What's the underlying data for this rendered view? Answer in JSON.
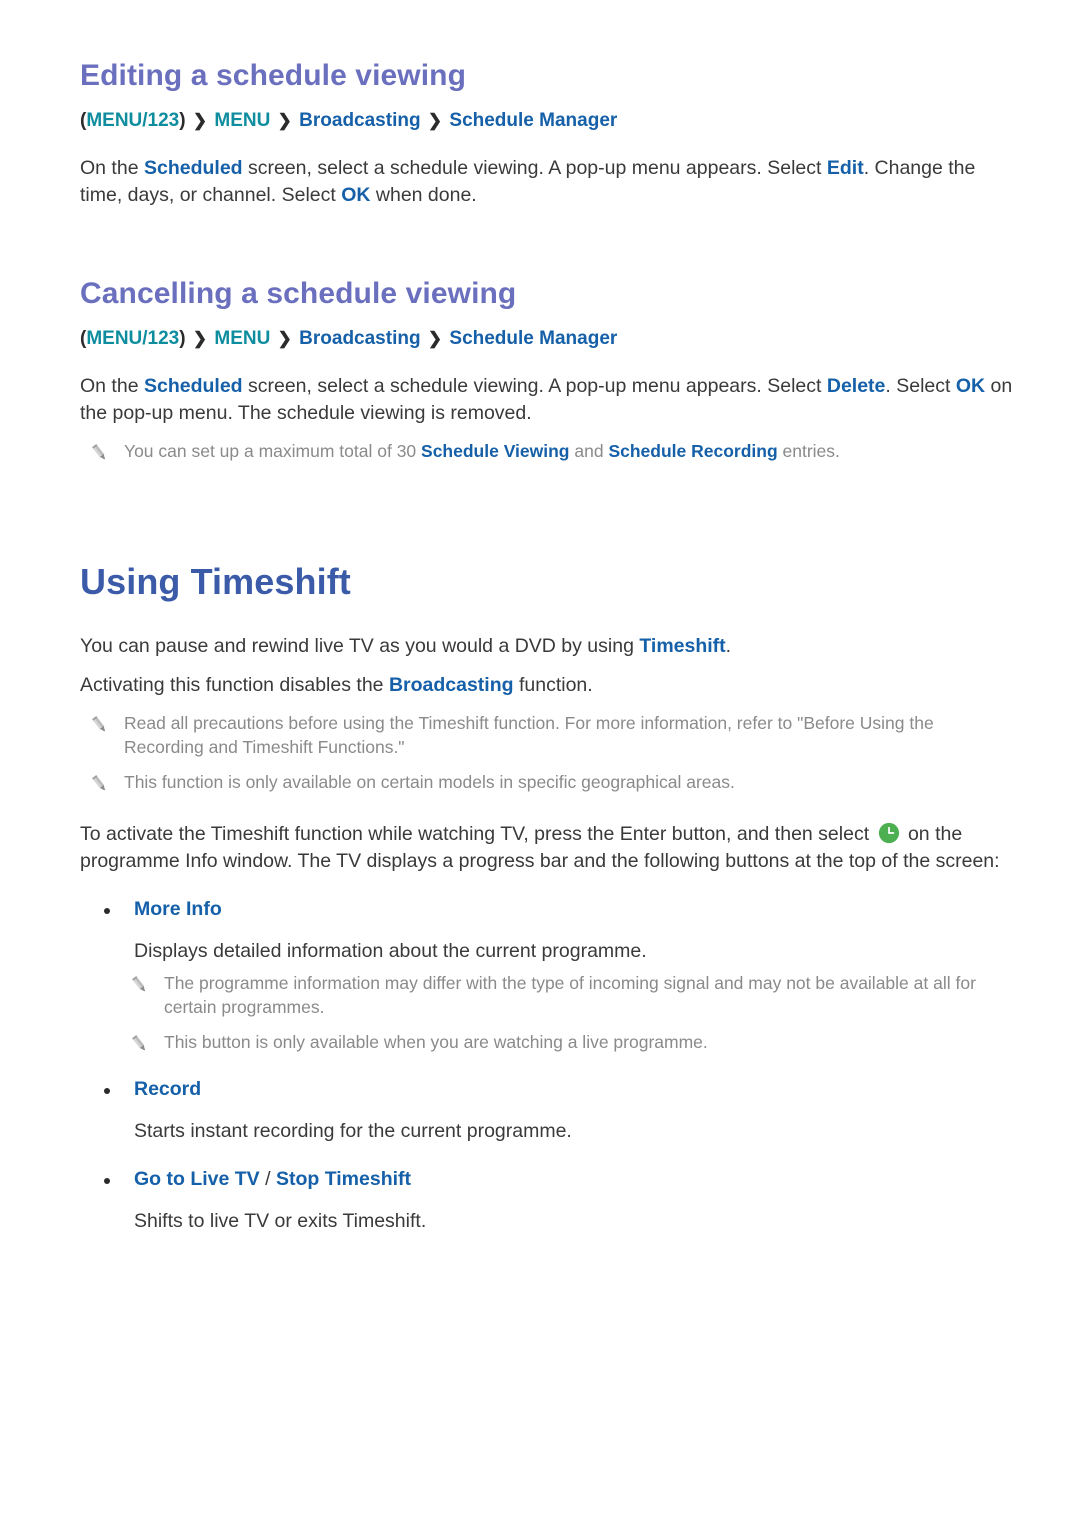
{
  "document": {
    "colors": {
      "section_heading": "#6a6fbe",
      "chapter_heading": "#3b5ba9",
      "link": "#1560a8",
      "menu_key": "#0e8d9f",
      "body_text": "#3a3a3a",
      "note_text": "#8a8a8a",
      "clock_icon_green": "#4caf50"
    }
  },
  "sections": [
    {
      "heading": "Editing a schedule viewing",
      "breadcrumb": {
        "menu_key": "MENU/123",
        "open_paren": "(",
        "close_paren": ")",
        "separator": "❯",
        "items": [
          "MENU",
          "Broadcasting",
          "Schedule Manager"
        ]
      },
      "paragraph": {
        "p1": "On the ",
        "link1": "Scheduled",
        "p2": " screen, select a schedule viewing. A pop-up menu appears. Select ",
        "link2": "Edit",
        "p3": ". Change the time, days, or channel. Select ",
        "link3": "OK",
        "p4": " when done."
      }
    },
    {
      "heading": "Cancelling a schedule viewing",
      "breadcrumb": {
        "menu_key": "MENU/123",
        "open_paren": "(",
        "close_paren": ")",
        "separator": "❯",
        "items": [
          "MENU",
          "Broadcasting",
          "Schedule Manager"
        ]
      },
      "paragraph": {
        "p1": "On the ",
        "link1": "Scheduled",
        "p2": " screen, select a schedule viewing. A pop-up menu appears. Select ",
        "link2": "Delete",
        "p3": ". Select ",
        "link3": "OK",
        "p4": " on the pop-up menu. The schedule viewing is removed."
      },
      "note": {
        "icon": "pencil-icon",
        "t1": "You can set up a maximum total of 30 ",
        "link1": "Schedule Viewing",
        "t2": " and ",
        "link2": "Schedule Recording",
        "t3": " entries."
      }
    }
  ],
  "chapter": {
    "title": "Using Timeshift",
    "intro": {
      "line1_p1": "You can pause and rewind live TV as you would a DVD by using ",
      "line1_link": "Timeshift",
      "line1_p2": ".",
      "line2_p1": "Activating this function disables the ",
      "line2_link": "Broadcasting",
      "line2_p2": " function."
    },
    "notes": [
      {
        "icon": "pencil-icon",
        "text": "Read all precautions before using the Timeshift function. For more information, refer to \"Before Using the Recording and Timeshift Functions.\""
      },
      {
        "icon": "pencil-icon",
        "text": "This function is only available on certain models in specific geographical areas."
      }
    ],
    "activation": {
      "p1": "To activate the Timeshift function while watching TV, press the Enter button, and then select ",
      "icon": "clock-icon",
      "p2": " on the programme Info window. The TV displays a progress bar and the following buttons at the top of the screen:"
    },
    "buttons": [
      {
        "label": "More Info",
        "label_alt": "",
        "separator": "",
        "description": "Displays detailed information about the current programme.",
        "notes": [
          {
            "icon": "pencil-icon",
            "text": "The programme information may differ with the type of incoming signal and may not be available at all for certain programmes."
          },
          {
            "icon": "pencil-icon",
            "text": "This button is only available when you are watching a live programme."
          }
        ]
      },
      {
        "label": "Record",
        "label_alt": "",
        "separator": "",
        "description": "Starts instant recording for the current programme.",
        "notes": []
      },
      {
        "label": "Go to Live TV",
        "label_alt": "Stop Timeshift",
        "separator": " / ",
        "description": "Shifts to live TV or exits Timeshift.",
        "notes": []
      }
    ]
  }
}
